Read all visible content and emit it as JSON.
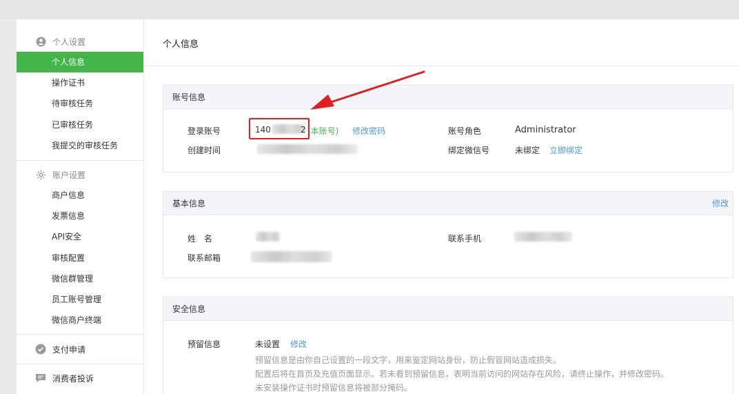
{
  "sidebar": {
    "group1_title": "个人设置",
    "group1_items": [
      "个人信息",
      "操作证书",
      "待审核任务",
      "已审核任务",
      "我提交的审核任务"
    ],
    "group2_title": "账户设置",
    "group2_items": [
      "商户信息",
      "发票信息",
      "API安全",
      "审核配置",
      "微信群管理",
      "员工账号管理",
      "微信商户终端"
    ],
    "pay_apply": "支付申请",
    "consumer_complaint": "消费者投诉"
  },
  "page": {
    "title": "个人信息"
  },
  "account": {
    "section_title": "账号信息",
    "login_label": "登录账号",
    "login_prefix": "140",
    "login_suffix": "2",
    "self_tag": "(本账号)",
    "change_password": "修改密码",
    "created_label": "创建时间",
    "role_label": "账号角色",
    "role_value": "Administrator",
    "wechat_label": "绑定微信号",
    "wechat_value": "未绑定",
    "bind_now": "立即绑定"
  },
  "basic": {
    "section_title": "基本信息",
    "edit": "修改",
    "name_label": "姓　名",
    "email_label": "联系邮箱",
    "phone_label": "联系手机"
  },
  "security": {
    "section_title": "安全信息",
    "reserved_label": "预留信息",
    "reserved_value": "未设置",
    "reserved_edit": "修改",
    "notes": [
      "预留信息是由你自己设置的一段文字，用来鉴定网站身份，防止假冒网站造成损失。",
      "配置后将在首页及充值页面显示。若未看到预留信息，表明当前访问的网站存在风险，请终止操作，并修改密码。",
      "未安装操作证书时预留信息将被部分掩码。"
    ]
  },
  "colors": {
    "accent": "#44b549",
    "link": "#459ae9",
    "highlight": "#e02020"
  },
  "icons": {
    "group1": "person-icon",
    "group2": "gear-icon",
    "pay": "check-circle-icon",
    "complaint": "chat-bubble-icon"
  }
}
